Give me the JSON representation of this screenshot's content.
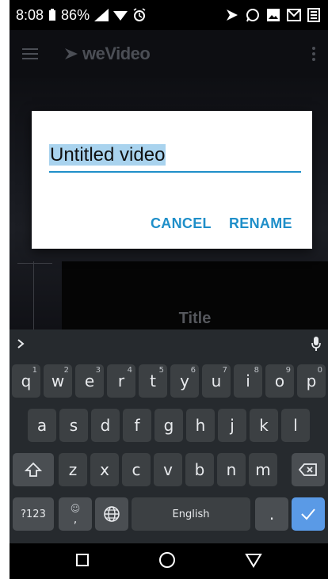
{
  "status_bar": {
    "time": "8:08",
    "battery": "86%",
    "icons_left": [
      "battery-icon",
      "signal-icon",
      "wifi-icon",
      "alarm-icon"
    ],
    "icons_right": [
      "wevideo-notification-icon",
      "whatsapp-icon",
      "image-icon",
      "gmail-icon",
      "news-icon"
    ]
  },
  "app": {
    "brand": "weVideo",
    "preview_title": "Title"
  },
  "dialog": {
    "input_value": "Untitled video",
    "cancel_label": "CANCEL",
    "rename_label": "RENAME",
    "accent_color": "#1f8fc9"
  },
  "keyboard": {
    "row1": [
      {
        "k": "q",
        "h": "1"
      },
      {
        "k": "w",
        "h": "2"
      },
      {
        "k": "e",
        "h": "3"
      },
      {
        "k": "r",
        "h": "4"
      },
      {
        "k": "t",
        "h": "5"
      },
      {
        "k": "y",
        "h": "6"
      },
      {
        "k": "u",
        "h": "7"
      },
      {
        "k": "i",
        "h": "8"
      },
      {
        "k": "o",
        "h": "9"
      },
      {
        "k": "p",
        "h": "0"
      }
    ],
    "row2": [
      "a",
      "s",
      "d",
      "f",
      "g",
      "h",
      "j",
      "k",
      "l"
    ],
    "row3": [
      "z",
      "x",
      "c",
      "v",
      "b",
      "n",
      "m"
    ],
    "symbols_label": "?123",
    "emoji_hint": "☺",
    "comma_label": ",",
    "space_label": "English",
    "period_label": ".",
    "enter_color": "#5a9ae6"
  }
}
